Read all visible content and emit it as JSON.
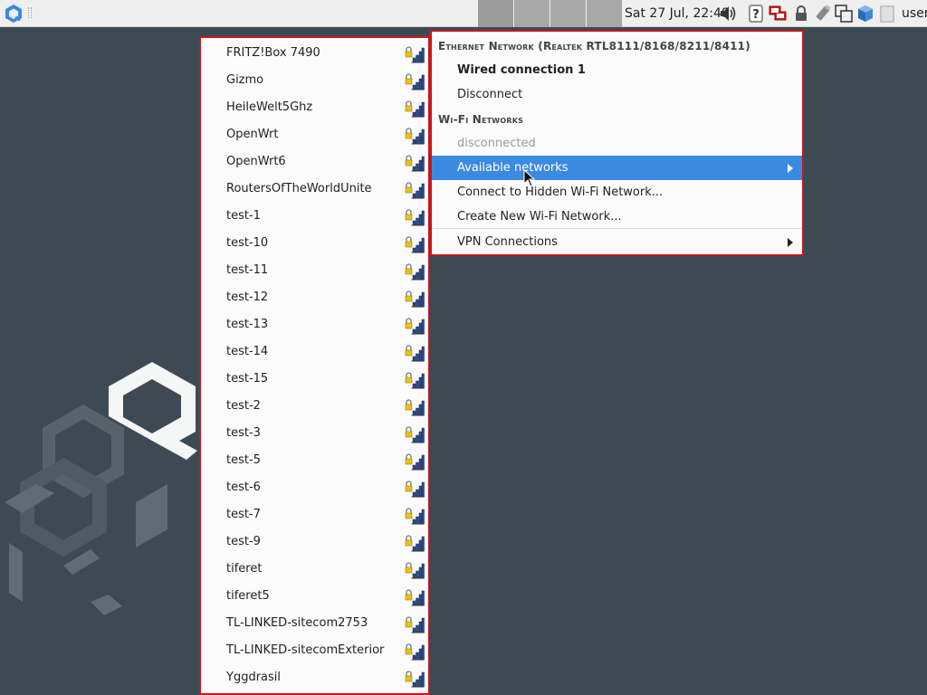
{
  "panel": {
    "start_icon": "qubes-logo-icon",
    "clock": "Sat 27 Jul, 22:48",
    "user": "user",
    "tray_icons": [
      "volume-icon",
      "help-icon",
      "network-wired-icon",
      "lock-icon",
      "usb-drive-icon",
      "window-manager-icon",
      "qube-cube-icon",
      "clipboard-icon"
    ]
  },
  "available_networks": [
    {
      "name": "FRITZ!Box 7490",
      "secured": true
    },
    {
      "name": "Gizmo",
      "secured": true
    },
    {
      "name": "HeileWelt5Ghz",
      "secured": true
    },
    {
      "name": "OpenWrt",
      "secured": true
    },
    {
      "name": "OpenWrt6",
      "secured": true
    },
    {
      "name": "RoutersOfTheWorldUnite",
      "secured": true
    },
    {
      "name": "test-1",
      "secured": true
    },
    {
      "name": "test-10",
      "secured": true
    },
    {
      "name": "test-11",
      "secured": true
    },
    {
      "name": "test-12",
      "secured": true
    },
    {
      "name": "test-13",
      "secured": true
    },
    {
      "name": "test-14",
      "secured": true
    },
    {
      "name": "test-15",
      "secured": true
    },
    {
      "name": "test-2",
      "secured": true
    },
    {
      "name": "test-3",
      "secured": true
    },
    {
      "name": "test-5",
      "secured": true
    },
    {
      "name": "test-6",
      "secured": true
    },
    {
      "name": "test-7",
      "secured": true
    },
    {
      "name": "test-9",
      "secured": true
    },
    {
      "name": "tiferet",
      "secured": true
    },
    {
      "name": "tiferet5",
      "secured": true
    },
    {
      "name": "TL-LINKED-sitecom2753",
      "secured": true
    },
    {
      "name": "TL-LINKED-sitecomExterior",
      "secured": true
    },
    {
      "name": "Yggdrasil",
      "secured": true
    }
  ],
  "menu": {
    "ethernet_header": "Ethernet Network (Realtek RTL8111/8168/8211/8411)",
    "wired_connection": "Wired connection 1",
    "disconnect": "Disconnect",
    "wifi_header": "Wi-Fi Networks",
    "wifi_status": "disconnected",
    "available_networks": "Available networks",
    "connect_hidden": "Connect to Hidden Wi-Fi Network...",
    "create_new": "Create New Wi-Fi Network...",
    "vpn": "VPN Connections"
  },
  "colors": {
    "highlight": "#3c8ae0",
    "menu_border": "#c8161c",
    "desktop": "#3d4a54"
  }
}
